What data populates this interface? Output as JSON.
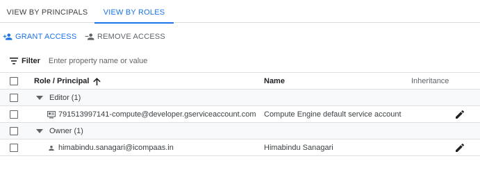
{
  "tabs": [
    {
      "label": "VIEW BY PRINCIPALS"
    },
    {
      "label": "VIEW BY ROLES"
    }
  ],
  "actions": {
    "grant_label": "GRANT ACCESS",
    "remove_label": "REMOVE ACCESS"
  },
  "filter": {
    "label": "Filter",
    "placeholder": "Enter property name or value"
  },
  "table": {
    "headers": {
      "role": "Role / Principal",
      "name": "Name",
      "inheritance": "Inheritance"
    },
    "groups": [
      {
        "label": "Editor (1)",
        "members": [
          {
            "principal": "791513997141-compute@developer.gserviceaccount.com",
            "name": "Compute Engine default service account",
            "icon": "service-account-icon"
          }
        ]
      },
      {
        "label": "Owner (1)",
        "members": [
          {
            "principal": "himabindu.sanagari@icompaas.in",
            "name": "Himabindu Sanagari",
            "icon": "person-icon"
          }
        ]
      }
    ]
  },
  "colors": {
    "accent": "#1a73e8",
    "text": "#202124",
    "muted": "#5f6368"
  }
}
